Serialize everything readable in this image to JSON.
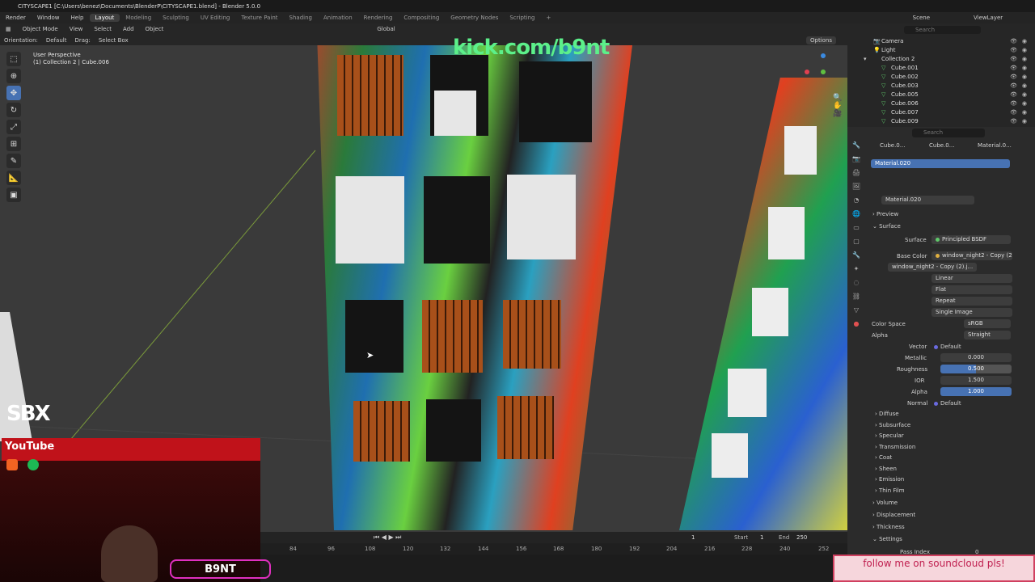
{
  "window": {
    "title": "CITYSCAPE1 [C:\\Users\\benez\\Documents\\BlenderP\\CITYSCAPE1.blend] - Blender 5.0.0"
  },
  "menu": {
    "items": [
      "File",
      "Edit",
      "Render",
      "Window",
      "Help"
    ],
    "workspaces": [
      "Layout",
      "Modeling",
      "Sculpting",
      "UV Editing",
      "Texture Paint",
      "Shading",
      "Animation",
      "Rendering",
      "Compositing",
      "Geometry Nodes",
      "Scripting"
    ],
    "active_workspace": "Layout",
    "scene": "Scene",
    "view_layer": "ViewLayer"
  },
  "toolbar": {
    "mode": "Object Mode",
    "items": [
      "View",
      "Select",
      "Add",
      "Object"
    ],
    "transform": "Global",
    "options": "Options"
  },
  "tool_settings": {
    "orientation_label": "Orientation:",
    "orientation_value": "Default",
    "drag_label": "Drag:",
    "drag_value": "Select Box"
  },
  "viewport": {
    "perspective": "User Perspective",
    "selection": "(1) Collection 2 | Cube.006"
  },
  "overlays": {
    "kick": "kick.com/b9nt",
    "sbx": "SBX",
    "youtube": "YouTube",
    "sign": "B9NT",
    "soundcloud": "follow me on soundcloud pls!"
  },
  "timeline": {
    "current_frame": "1",
    "start_label": "Start",
    "start": "1",
    "end_label": "End",
    "end": "250",
    "ticks": [
      "84",
      "96",
      "108",
      "120",
      "132",
      "144",
      "156",
      "168",
      "180",
      "192",
      "204",
      "216",
      "228",
      "240",
      "252"
    ]
  },
  "outliner": {
    "search_placeholder": "Search",
    "rows": [
      {
        "label": "Camera",
        "indent": 1
      },
      {
        "label": "Light",
        "indent": 1
      },
      {
        "label": "Collection 2",
        "indent": 0
      },
      {
        "label": "Cube.001",
        "indent": 1
      },
      {
        "label": "Cube.002",
        "indent": 1
      },
      {
        "label": "Cube.003",
        "indent": 1
      },
      {
        "label": "Cube.005",
        "indent": 1
      },
      {
        "label": "Cube.006",
        "indent": 1
      },
      {
        "label": "Cube.007",
        "indent": 1
      },
      {
        "label": "Cube.009",
        "indent": 1
      }
    ]
  },
  "properties": {
    "search_placeholder": "Search",
    "breadcrumb": [
      "Cube.0...",
      "Cube.0...",
      "Material.0..."
    ],
    "material_slot": "Material.020",
    "material_name": "Material.020",
    "preview": "Preview",
    "surface": "Surface",
    "surface_label": "Surface",
    "surface_value": "Principled BSDF",
    "base_color_label": "Base Color",
    "base_color_value": "window_night2 - Copy (2...",
    "image_name": "window_night2 - Copy (2).j...",
    "interpolation": "Linear",
    "projection": "Flat",
    "extension": "Repeat",
    "source": "Single Image",
    "color_space_label": "Color Space",
    "color_space": "sRGB",
    "alpha_mode_label": "Alpha",
    "alpha_mode": "Straight",
    "vector_label": "Vector",
    "vector": "Default",
    "metallic_label": "Metallic",
    "metallic": "0.000",
    "roughness_label": "Roughness",
    "roughness": "0.500",
    "ior_label": "IOR",
    "ior": "1.500",
    "alpha_label": "Alpha",
    "alpha": "1.000",
    "normal_label": "Normal",
    "normal": "Default",
    "sections": [
      "Diffuse",
      "Subsurface",
      "Specular",
      "Transmission",
      "Coat",
      "Sheen",
      "Emission",
      "Thin Film"
    ],
    "sections2": [
      "Volume",
      "Displacement",
      "Thickness",
      "Settings"
    ],
    "pass_index_label": "Pass Index",
    "pass_index": "0"
  },
  "colors": {
    "accent": "#4772b3",
    "kick_green": "#5cf08a",
    "youtube_red": "#c0121a"
  }
}
